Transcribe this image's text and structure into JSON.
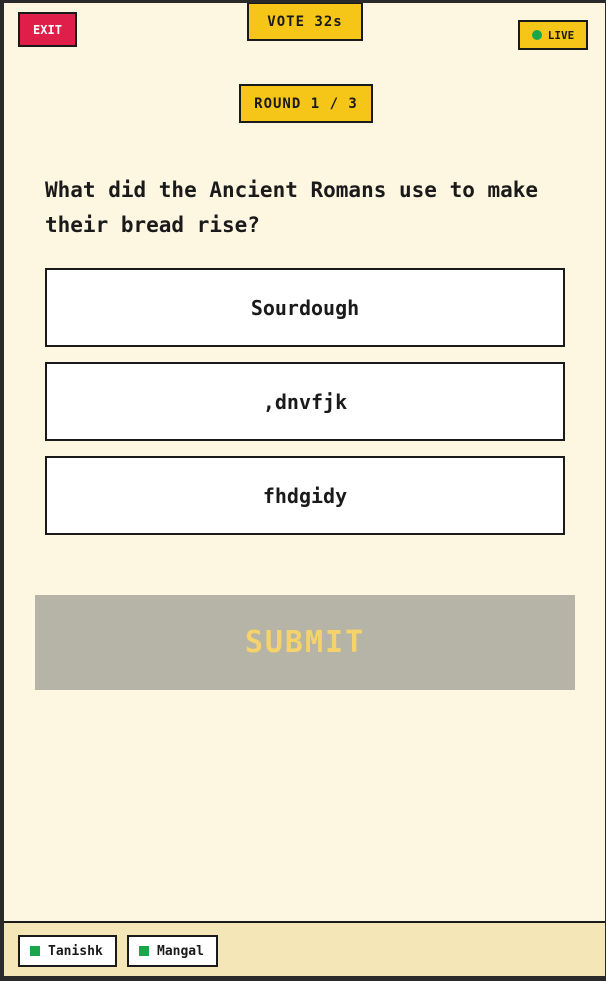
{
  "header": {
    "exit_label": "EXIT",
    "vote_timer": "VOTE 32s",
    "live_label": "LIVE",
    "round_label": "ROUND 1 / 3"
  },
  "question": {
    "text": "What did the Ancient Romans use to make their bread rise?"
  },
  "options": [
    {
      "label": "Sourdough"
    },
    {
      "label": ",dnvfjk"
    },
    {
      "label": "fhdgidy"
    }
  ],
  "submit": {
    "label": "SUBMIT",
    "state": "disabled"
  },
  "players": [
    {
      "name": "Tanishk",
      "status_color": "#1aa64b"
    },
    {
      "name": "Mangal",
      "status_color": "#1aa64b"
    }
  ],
  "colors": {
    "accent_yellow": "#f5c518",
    "exit_red": "#e01e4a",
    "live_green": "#1aa64b",
    "background": "#fdf6e0",
    "submit_disabled": "#b5b4a6"
  }
}
